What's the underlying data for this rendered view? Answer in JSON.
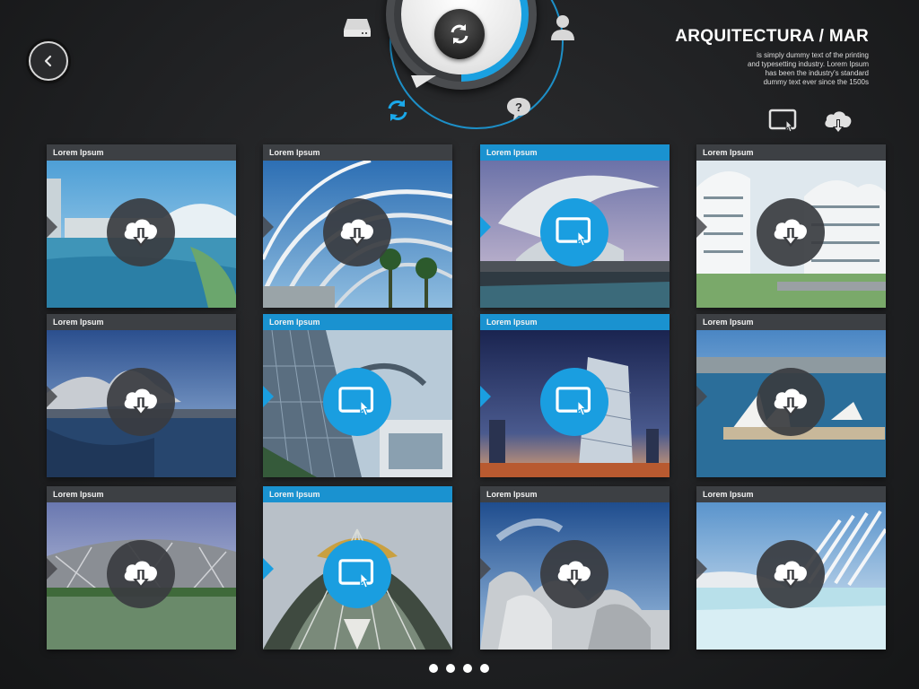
{
  "header": {
    "title": "ARQUITECTURA / MAR",
    "description": "is simply dummy text of the printing and typesetting industry. Lorem Ipsum has been the industry's standard dummy text ever since the 1500s"
  },
  "icons": {
    "back": "back-arrow-icon",
    "dial_center": "refresh-icon",
    "dial_options": [
      "hard-drive-icon",
      "user-icon",
      "sync-icon",
      "help-icon"
    ],
    "top_actions": [
      "touch-screen-icon",
      "cloud-download-icon"
    ]
  },
  "colors": {
    "accent": "#1a9ee0",
    "tile_header": "#3d4044",
    "background": "#1f2022"
  },
  "tiles": [
    {
      "label": "Lorem Ipsum",
      "action": "cloud-download-icon",
      "active": false
    },
    {
      "label": "Lorem Ipsum",
      "action": "cloud-download-icon",
      "active": false
    },
    {
      "label": "Lorem Ipsum",
      "action": "touch-screen-icon",
      "active": true
    },
    {
      "label": "Lorem Ipsum",
      "action": "cloud-download-icon",
      "active": false
    },
    {
      "label": "Lorem Ipsum",
      "action": "cloud-download-icon",
      "active": false
    },
    {
      "label": "Lorem Ipsum",
      "action": "touch-screen-icon",
      "active": true
    },
    {
      "label": "Lorem Ipsum",
      "action": "touch-screen-icon",
      "active": true
    },
    {
      "label": "Lorem Ipsum",
      "action": "cloud-download-icon",
      "active": false
    },
    {
      "label": "Lorem Ipsum",
      "action": "cloud-download-icon",
      "active": false
    },
    {
      "label": "Lorem Ipsum",
      "action": "touch-screen-icon",
      "active": true
    },
    {
      "label": "Lorem Ipsum",
      "action": "cloud-download-icon",
      "active": false
    },
    {
      "label": "Lorem Ipsum",
      "action": "cloud-download-icon",
      "active": false
    }
  ],
  "pagination": {
    "pages": 4,
    "current": 1
  }
}
